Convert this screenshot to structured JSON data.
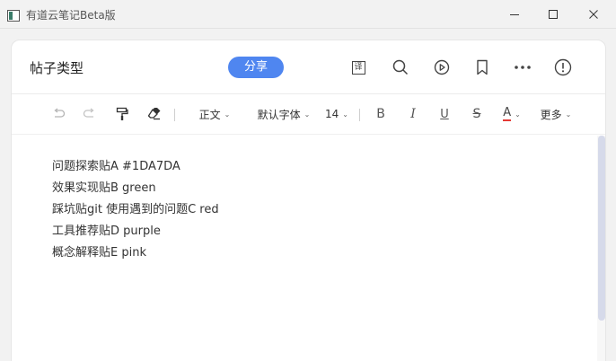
{
  "window": {
    "title": "有道云笔记Beta版"
  },
  "header": {
    "doc_title": "帖子类型",
    "share_label": "分享",
    "translate_icon_text": "译"
  },
  "toolbar": {
    "paragraph_label": "正文",
    "font_label": "默认字体",
    "size_label": "14",
    "bold_label": "B",
    "italic_label": "I",
    "underline_label": "U",
    "strike_label": "S",
    "color_label": "A",
    "more_label": "更多",
    "caret": "⌄"
  },
  "content": {
    "lines": [
      "问题探索贴A #1DA7DA",
      "效果实现贴B green",
      "踩坑贴git 使用遇到的问题C red",
      "工具推荐贴D purple",
      "概念解释贴E pink"
    ]
  },
  "colors": {
    "accent": "#4f86f0",
    "text_color_underline": "#e53935"
  }
}
